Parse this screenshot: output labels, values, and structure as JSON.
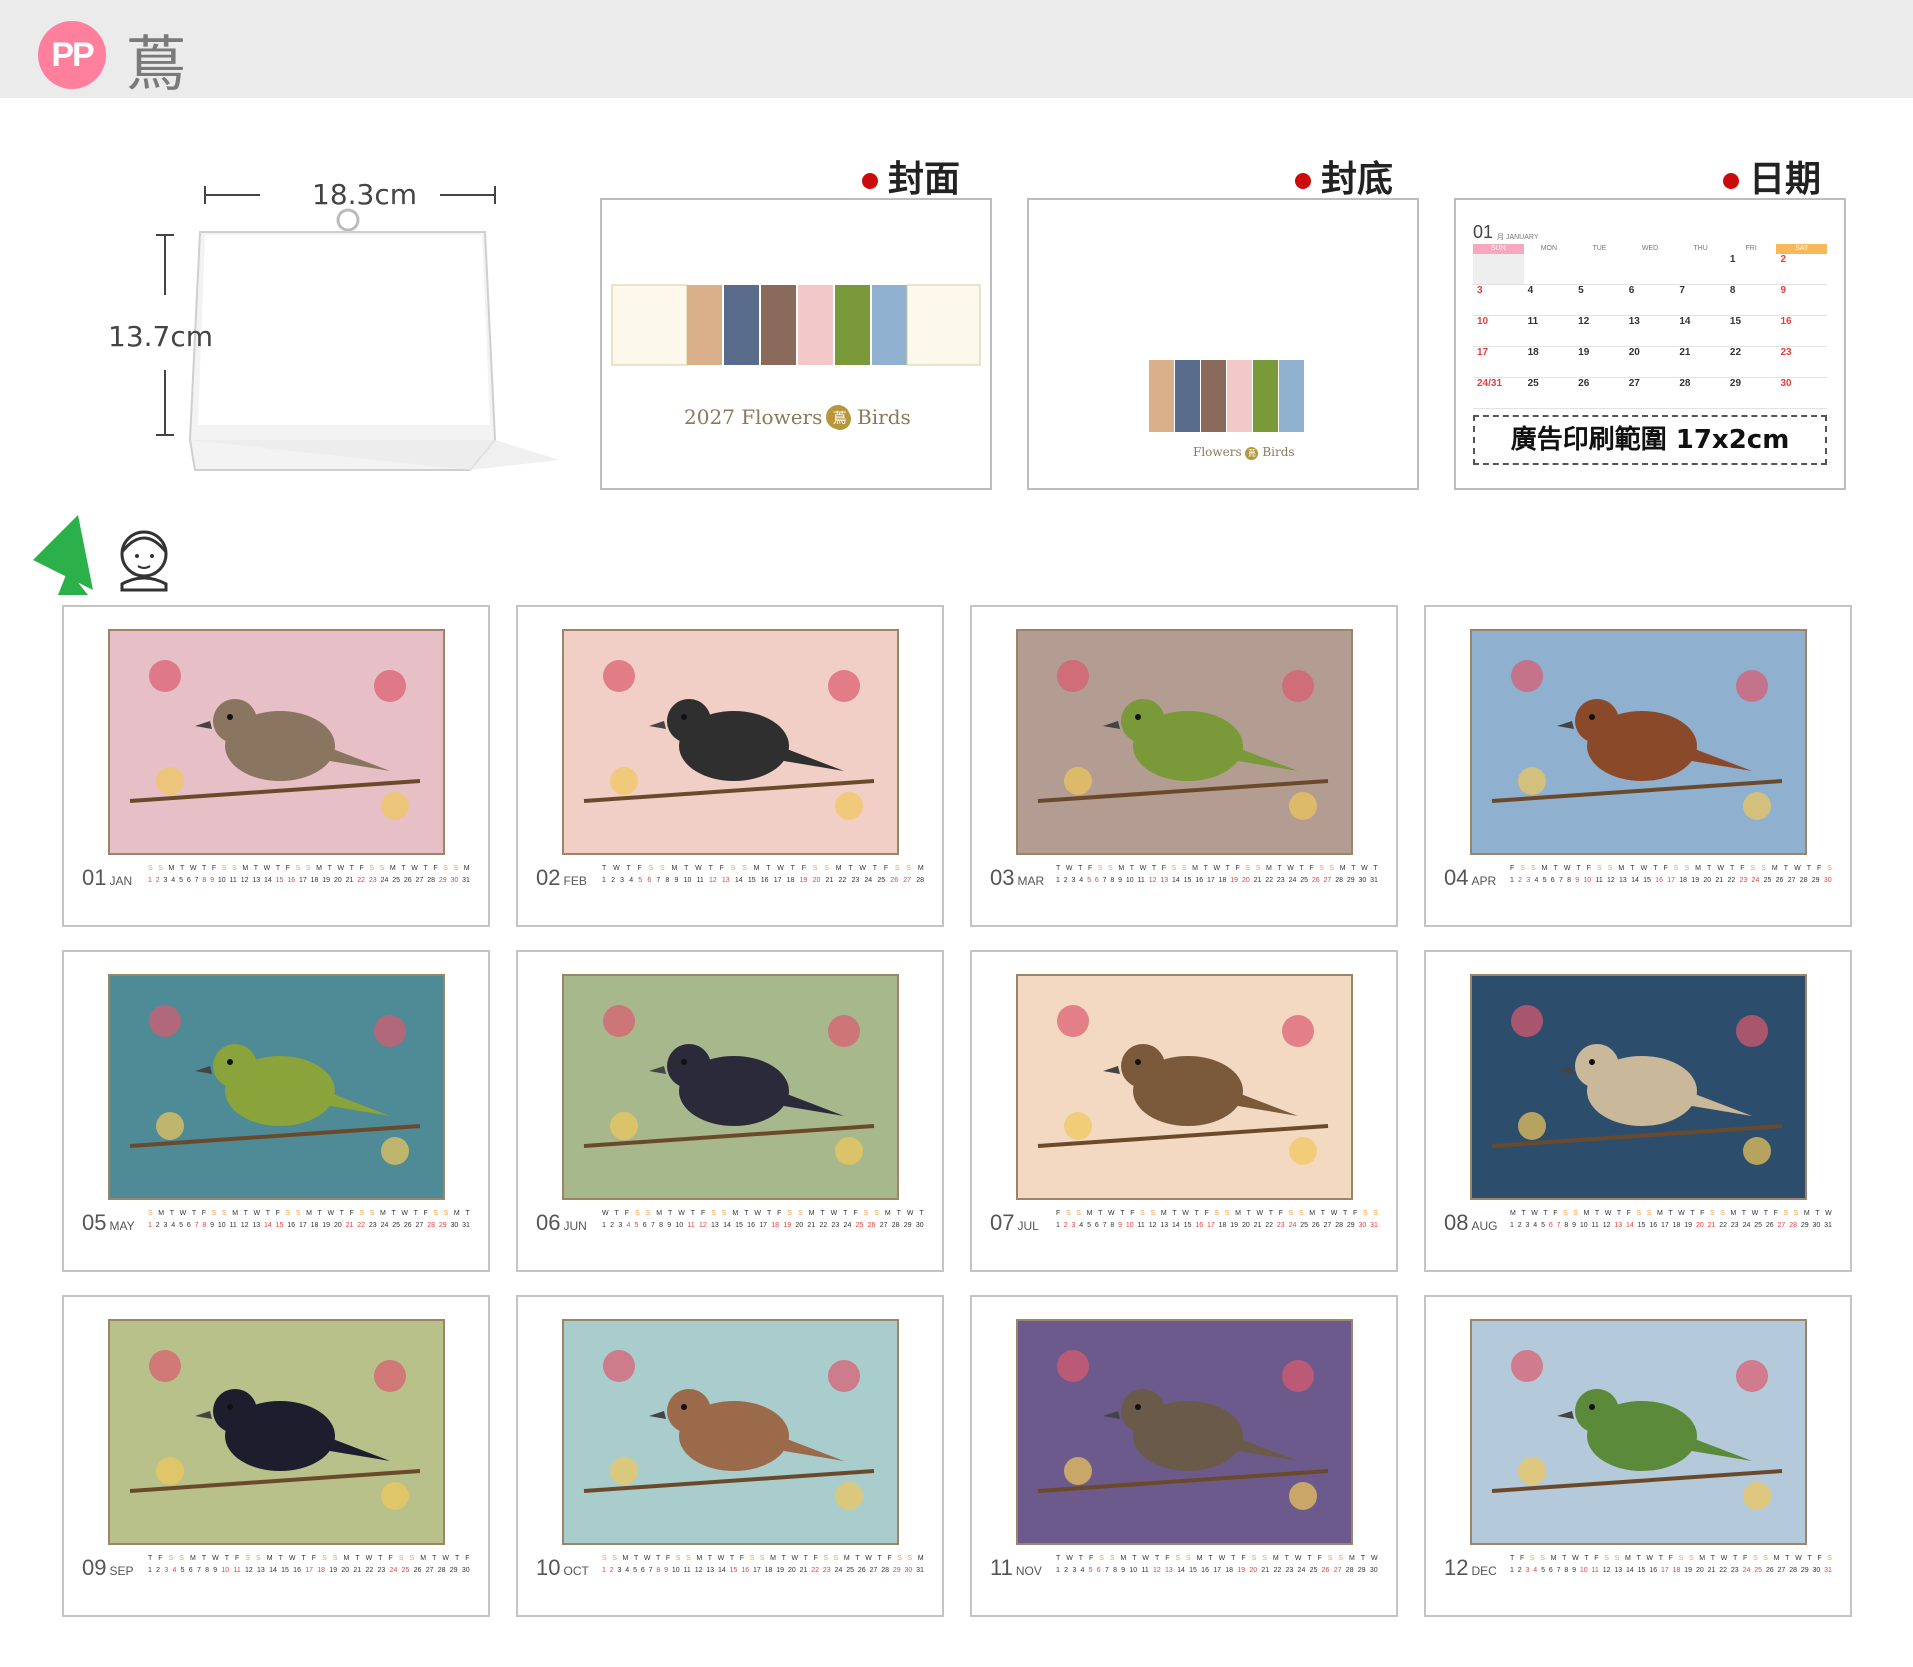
{
  "brand": {
    "badge": "PP",
    "name": "蔦"
  },
  "size_diagram": {
    "width_label": "18.3cm",
    "height_label": "13.7cm"
  },
  "headers": {
    "cover": "封面",
    "back": "封底",
    "date": "日期"
  },
  "cover": {
    "title_year": "2027",
    "title_left": "Flowers",
    "title_seal": "蔦",
    "title_right": "Birds"
  },
  "back": {
    "left": "Flowers",
    "seal": "蔦",
    "right": "Birds"
  },
  "date_panel": {
    "month_num": "01",
    "month_en": "月 JANUARY",
    "weekdays": [
      "SUN",
      "MON",
      "TUE",
      "WED",
      "THU",
      "FRI",
      "SAT"
    ],
    "weeks": [
      [
        "",
        "",
        "",
        "",
        "",
        "1",
        "2"
      ],
      [
        "3",
        "4",
        "5",
        "6",
        "7",
        "8",
        "9"
      ],
      [
        "10",
        "11",
        "12",
        "13",
        "14",
        "15",
        "16"
      ],
      [
        "17",
        "18",
        "19",
        "20",
        "21",
        "22",
        "23"
      ],
      [
        "24/31",
        "25",
        "26",
        "27",
        "28",
        "29",
        "30"
      ]
    ],
    "ad_text": "廣告印刷範圍 17x2cm"
  },
  "colors": {
    "accent_red": "#cc0a0a",
    "badge_pink": "#ff7f9c",
    "sun_pink": "#f7a8c0",
    "sat_orange": "#f7b85a"
  },
  "months": [
    {
      "num": "01",
      "en": "JAN",
      "bg": "#e7bfc6",
      "bird": "#8a7560",
      "starts": 5,
      "days": 31
    },
    {
      "num": "02",
      "en": "FEB",
      "bg": "#f1cfc6",
      "bird": "#2f2f2f",
      "starts": 1,
      "days": 28
    },
    {
      "num": "03",
      "en": "MAR",
      "bg": "#b39c92",
      "bird": "#7a9a3a",
      "starts": 1,
      "days": 31
    },
    {
      "num": "04",
      "en": "APR",
      "bg": "#8fb0cf",
      "bird": "#8a4a2a",
      "starts": 4,
      "days": 30
    },
    {
      "num": "05",
      "en": "MAY",
      "bg": "#4f8a97",
      "bird": "#8aa33a",
      "starts": 6,
      "days": 31
    },
    {
      "num": "06",
      "en": "JUN",
      "bg": "#a7b98c",
      "bird": "#2a2a3a",
      "starts": 2,
      "days": 30
    },
    {
      "num": "07",
      "en": "JUL",
      "bg": "#f3d9c2",
      "bird": "#7a5a3a",
      "starts": 4,
      "days": 31
    },
    {
      "num": "08",
      "en": "AUG",
      "bg": "#2d4d6d",
      "bird": "#c9b89a",
      "starts": 0,
      "days": 31
    },
    {
      "num": "09",
      "en": "SEP",
      "bg": "#b7c189",
      "bird": "#1d1d2d",
      "starts": 3,
      "days": 30
    },
    {
      "num": "10",
      "en": "OCT",
      "bg": "#a9cccc",
      "bird": "#9a6a4a",
      "starts": 5,
      "days": 31
    },
    {
      "num": "11",
      "en": "NOV",
      "bg": "#6d5a8c",
      "bird": "#6a5a4a",
      "starts": 1,
      "days": 30
    },
    {
      "num": "12",
      "en": "DEC",
      "bg": "#b4c9d9",
      "bird": "#5a8a3a",
      "starts": 3,
      "days": 31
    }
  ]
}
